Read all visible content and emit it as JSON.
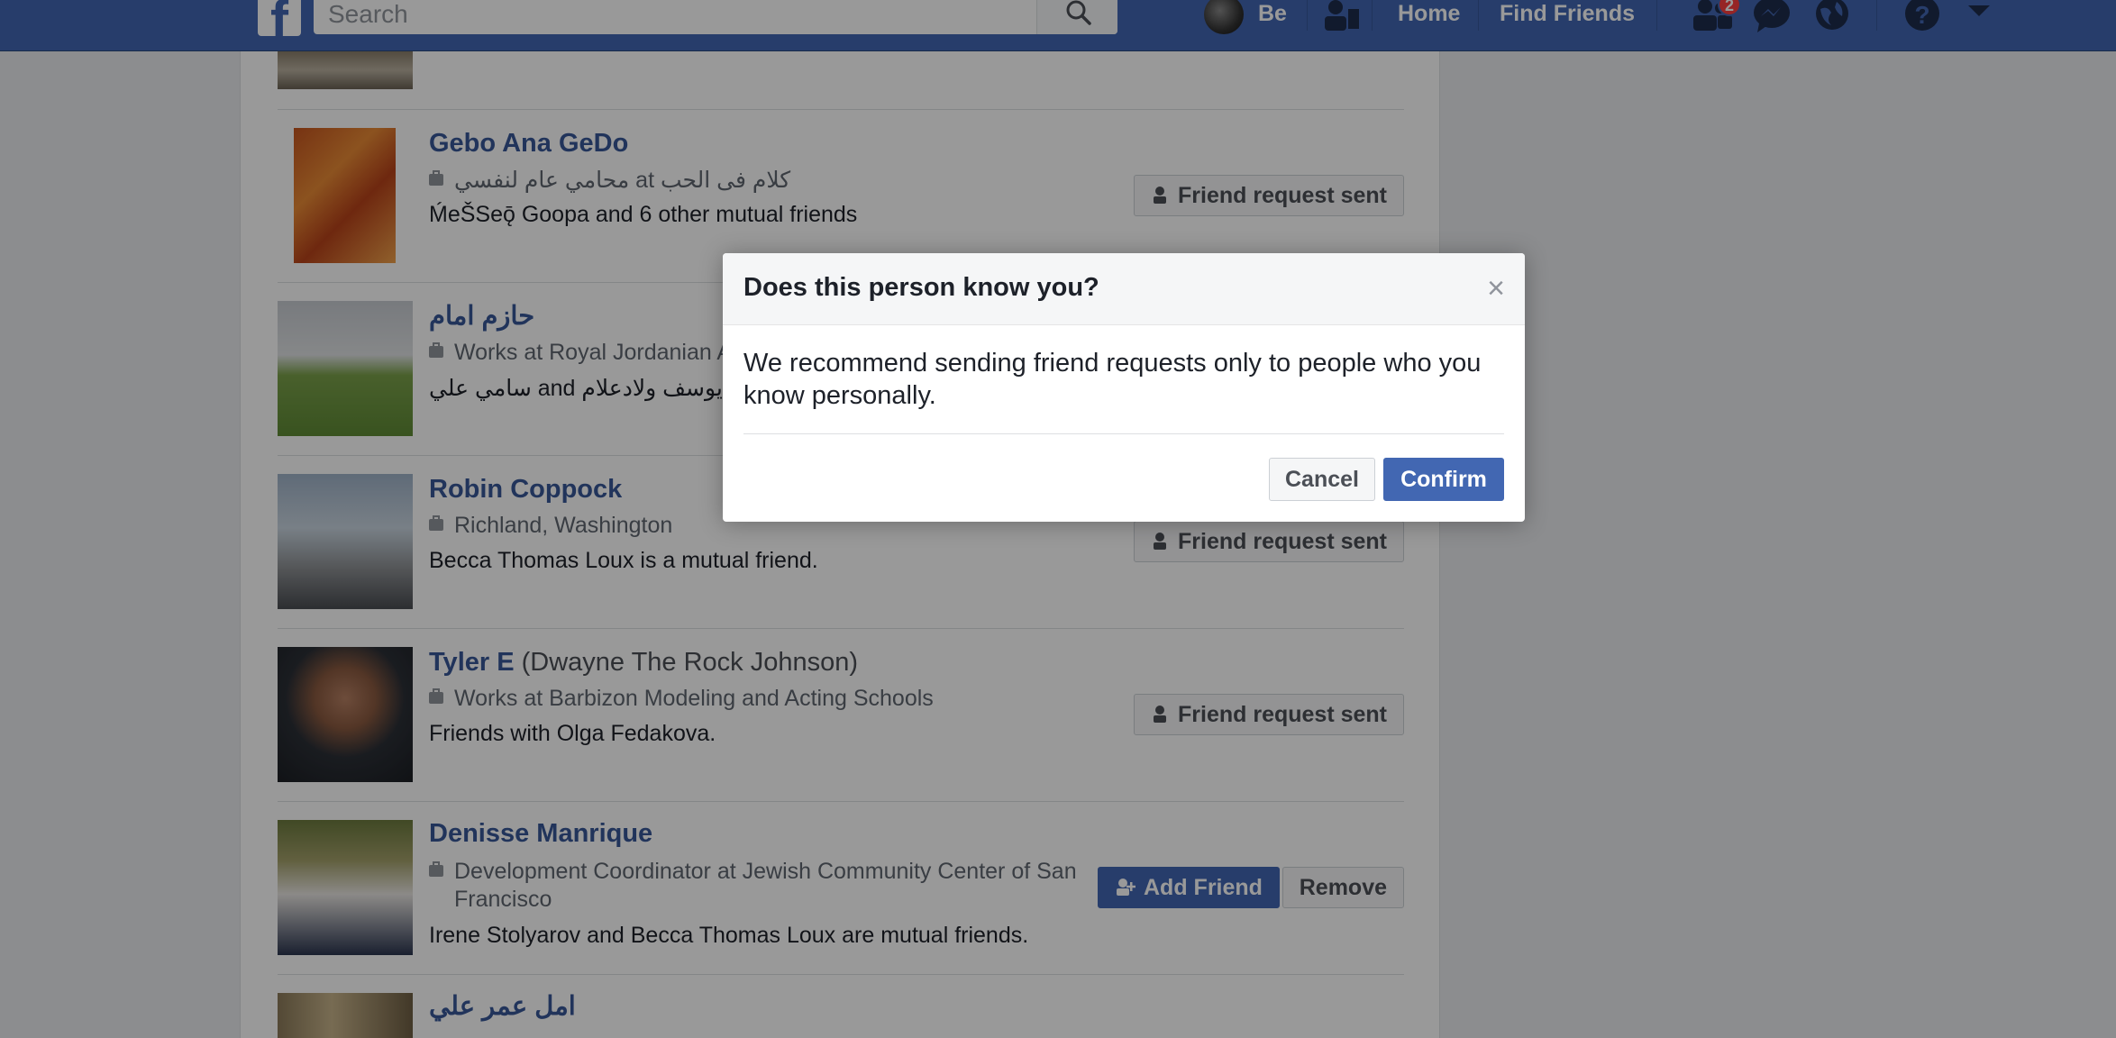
{
  "nav": {
    "logo": "f",
    "search_placeholder": "Search",
    "profile_name": "Be",
    "home": "Home",
    "find_friends": "Find Friends",
    "friend_requests_badge": "2"
  },
  "people": [
    {
      "name": "Gebo Ana GeDo",
      "alt_name": "",
      "work": "محامي عام لنفسي at كلام فى الحب",
      "mutual": "ḾeŠSeǭ Goopa and 6 other mutual friends",
      "action": "Friend request sent"
    },
    {
      "name": "حازم امام",
      "alt_name": "",
      "work": "Works at Royal Jordanian A",
      "mutual": "سامي علي and يوسف ولادعلام ar",
      "action": ""
    },
    {
      "name": "Robin Coppock",
      "alt_name": "",
      "work": "Richland, Washington",
      "mutual": "Becca Thomas Loux is a mutual friend.",
      "action": "Friend request sent"
    },
    {
      "name": "Tyler E",
      "alt_name": "(Dwayne The Rock Johnson)",
      "work": "Works at Barbizon Modeling and Acting Schools",
      "mutual": "Friends with Olga Fedakova.",
      "action": "Friend request sent"
    },
    {
      "name": "Denisse Manrique",
      "alt_name": "",
      "work_line1": "Development Coordinator at Jewish Community Center of San",
      "work_line2": "Francisco",
      "mutual": "Irene Stolyarov and Becca Thomas Loux are mutual friends.",
      "add_label": "Add Friend",
      "remove_label": "Remove"
    },
    {
      "name": "امل عمر علي"
    }
  ],
  "dialog": {
    "title": "Does this person know you?",
    "close": "×",
    "body": "We recommend sending friend requests only to people who you know personally.",
    "cancel": "Cancel",
    "confirm": "Confirm"
  }
}
